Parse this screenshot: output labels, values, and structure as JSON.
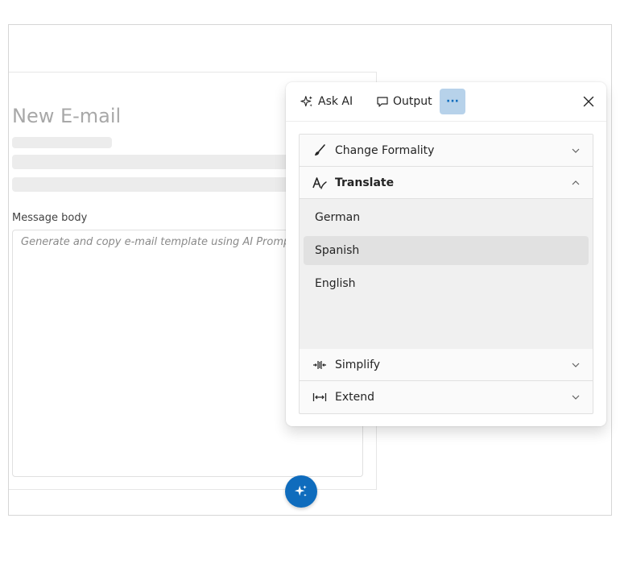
{
  "email": {
    "title": "New E-mail",
    "message_label": "Message body",
    "message_placeholder": "Generate and copy e-mail template using AI Prompt C",
    "fab_icon": "sparkle-icon"
  },
  "popup": {
    "tabs": [
      {
        "label": "Ask AI",
        "icon": "sparkle-icon"
      },
      {
        "label": "Output",
        "icon": "chat-bubble-icon"
      },
      {
        "label": "···",
        "icon": "more-icon"
      }
    ],
    "close_icon": "close-icon",
    "commands": [
      {
        "label": "Change Formality",
        "icon": "brush-icon",
        "expanded": false
      },
      {
        "label": "Translate",
        "icon": "translate-icon",
        "expanded": true,
        "options": [
          "German",
          "Spanish",
          "English"
        ],
        "selected": "Spanish"
      },
      {
        "label": "Simplify",
        "icon": "simplify-icon",
        "expanded": false
      },
      {
        "label": "Extend",
        "icon": "extend-icon",
        "expanded": false
      }
    ]
  },
  "colors": {
    "accent": "#0f6cbd",
    "accent_light": "#b7d2ea",
    "selected_option": "#e1e1e1"
  }
}
